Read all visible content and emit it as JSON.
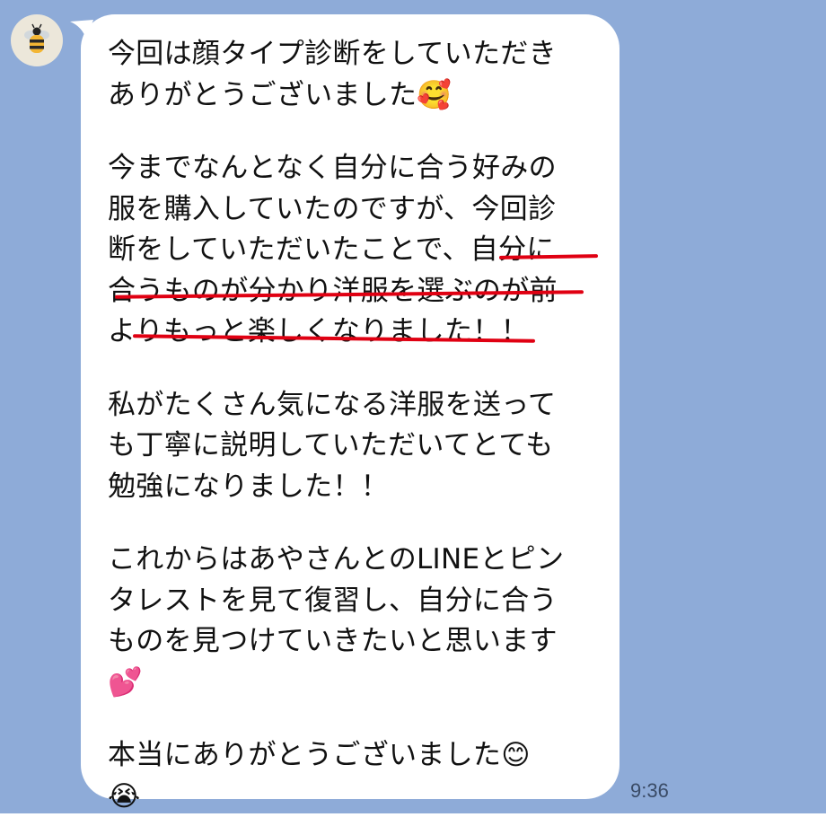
{
  "chat": {
    "time": "9:36",
    "sender_avatar_icon": "bee-icon",
    "colors": {
      "background": "#8eabd8",
      "bubble": "#ffffff",
      "text": "#111111",
      "underline": "#e00012"
    },
    "lines": [
      "今回は顔タイプ診断をしていただき",
      "ありがとうございました🥰",
      "",
      "今までなんとなく自分に合う好みの",
      "服を購入していたのですが、今回診",
      "断をしていただいたことで、自分に",
      "合うものが分かり洋服を選ぶのが前",
      "よりもっと楽しくなりました！！",
      "",
      "私がたくさん気になる洋服を送って",
      "も丁寧に説明していただいてとても",
      "勉強になりました！！",
      "",
      "これからはあやさんとのLINEとピン",
      "タレストを見て復習し、自分に合う",
      "ものを見つけていきたいと思います",
      "💕",
      "",
      "本当にありがとうございました😊",
      "😭"
    ]
  }
}
